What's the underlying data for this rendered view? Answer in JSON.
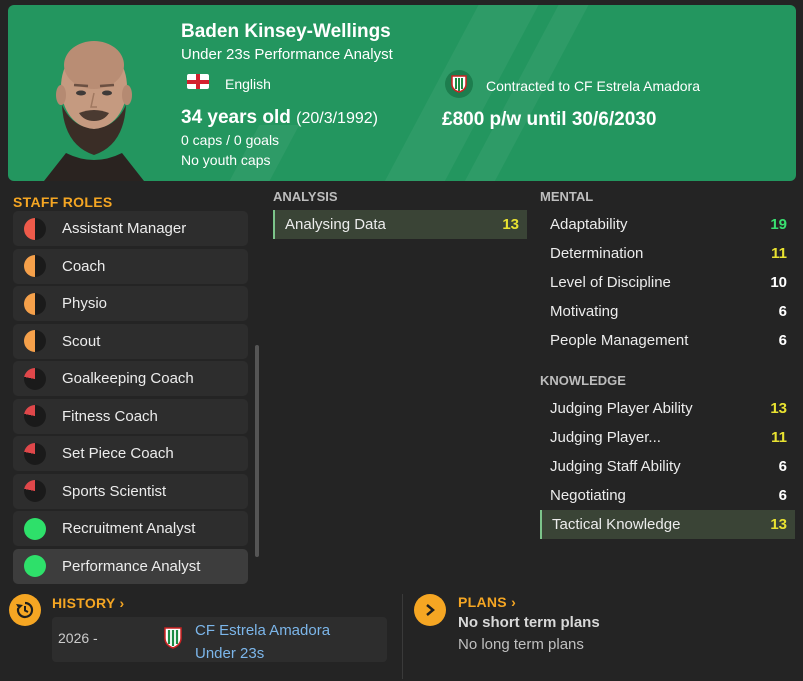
{
  "header": {
    "name": "Baden Kinsey-Wellings",
    "job": "Under 23s Performance Analyst",
    "nationality": "English",
    "age": "34 years old",
    "dob": "(20/3/1992)",
    "caps": "0 caps / 0 goals",
    "youth_caps": "No youth caps",
    "contract": "Contracted to CF Estrela Amadora",
    "wage": "£800 p/w until 30/6/2030",
    "accent": "#23965f"
  },
  "staff_roles": {
    "title": "STAFF ROLES",
    "items": [
      {
        "label": "Assistant Manager",
        "icon": "half-red-circle"
      },
      {
        "label": "Coach",
        "icon": "half-orange-circle"
      },
      {
        "label": "Physio",
        "icon": "half-orange-circle"
      },
      {
        "label": "Scout",
        "icon": "half-orange-circle"
      },
      {
        "label": "Goalkeeping Coach",
        "icon": "sliver-red-circle"
      },
      {
        "label": "Fitness Coach",
        "icon": "sliver-red-circle"
      },
      {
        "label": "Set Piece Coach",
        "icon": "sliver-red-circle"
      },
      {
        "label": "Sports Scientist",
        "icon": "sliver-red-circle"
      },
      {
        "label": "Recruitment Analyst",
        "icon": "full-green-circle"
      },
      {
        "label": "Performance Analyst",
        "icon": "full-green-circle"
      }
    ]
  },
  "analysis": {
    "title": "ANALYSIS",
    "items": [
      {
        "label": "Analysing Data",
        "value": "13"
      }
    ]
  },
  "mental": {
    "title": "MENTAL",
    "items": [
      {
        "label": "Adaptability",
        "value": "19"
      },
      {
        "label": "Determination",
        "value": "11"
      },
      {
        "label": "Level of Discipline",
        "value": "10"
      },
      {
        "label": "Motivating",
        "value": "6"
      },
      {
        "label": "People Management",
        "value": "6"
      }
    ]
  },
  "knowledge": {
    "title": "KNOWLEDGE",
    "items": [
      {
        "label": "Judging Player Ability",
        "value": "13"
      },
      {
        "label": "Judging Player...",
        "value": "11"
      },
      {
        "label": "Judging Staff Ability",
        "value": "6"
      },
      {
        "label": "Negotiating",
        "value": "6"
      },
      {
        "label": "Tactical Knowledge",
        "value": "13"
      }
    ]
  },
  "history": {
    "title": "HISTORY",
    "year": "2026 -",
    "club": "CF Estrela Amadora",
    "team": "Under 23s"
  },
  "plans": {
    "title": "PLANS",
    "short": "No short term plans",
    "long": "No long term plans"
  }
}
